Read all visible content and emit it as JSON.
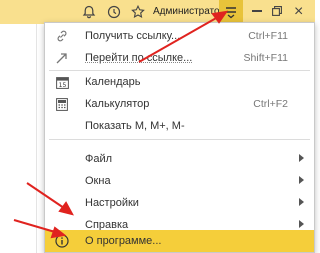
{
  "topbar": {
    "user": "Администратор"
  },
  "menu": {
    "items": [
      {
        "label": "Получить ссылку...",
        "shortcut": "Ctrl+F11",
        "icon": "link-icon"
      },
      {
        "label": "Перейти по ссылке...",
        "shortcut": "Shift+F11",
        "icon": "follow-link-icon"
      },
      {
        "label": "Календарь",
        "shortcut": "",
        "icon": "calendar-icon"
      },
      {
        "label": "Калькулятор",
        "shortcut": "Ctrl+F2",
        "icon": "calculator-icon"
      },
      {
        "label": "Показать М, М+, М-",
        "shortcut": ""
      },
      {
        "label": "Файл",
        "submenu": true
      },
      {
        "label": "Окна",
        "submenu": true
      },
      {
        "label": "Настройки",
        "submenu": true
      },
      {
        "label": "Справка",
        "submenu": true
      },
      {
        "label": "О программе...",
        "icon": "info-icon",
        "highlighted": true
      }
    ]
  },
  "colors": {
    "topbar": "#f9e08e",
    "highlight": "#f5ce3a",
    "annotation_arrow": "#e0231f"
  }
}
